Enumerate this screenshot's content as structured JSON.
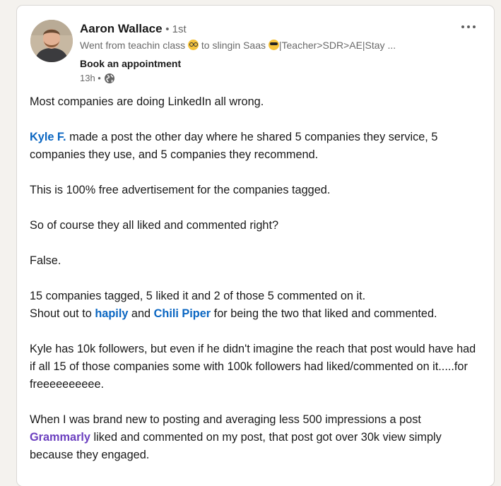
{
  "post": {
    "author": {
      "name": "Aaron Wallace",
      "degree": "• 1st",
      "headline_part1": "Went from teachin class",
      "headline_part2": "to slingin Saas",
      "headline_part3": "|Teacher>SDR>AE|Stay ...",
      "cta": "Book an appointment",
      "time": "13h •"
    },
    "body": {
      "p1": "Most companies are doing LinkedIn all wrong.",
      "p2_mention": "Kyle F.",
      "p2_text": " made a post the other day where he shared 5 companies they service, 5 companies they use, and 5 companies they recommend.",
      "p3": "This is 100% free advertisement for the companies tagged.",
      "p4": "So of course they all liked and commented right?",
      "p5": "False.",
      "p6_line1": "15 companies tagged, 5 liked it and 2 of those 5 commented on it.",
      "p6_line2_a": "Shout out to ",
      "p6_mention1": "hapily",
      "p6_line2_b": " and ",
      "p6_mention2": "Chili Piper",
      "p6_line2_c": " for being the two that liked and commented.",
      "p7": "Kyle has 10k followers, but even if he didn't imagine the reach that post would have had if all 15 of those companies some with 100k followers had liked/commented on it.....for freeeeeeeeee.",
      "p8_a": "When I was brand new to posting and averaging less 500 impressions a post ",
      "p8_mention": "Grammarly",
      "p8_b": " liked and commented on my post, that post got over 30k view simply because they engaged."
    },
    "icons": {
      "more": "more-options-icon",
      "globe": "globe-icon",
      "emoji1": "nerd-face-emoji",
      "emoji2": "sunglasses-emoji"
    },
    "colors": {
      "mention": "#0a66c2",
      "mention_company": "#6b3fbf",
      "background": "#f4f2ee"
    }
  }
}
